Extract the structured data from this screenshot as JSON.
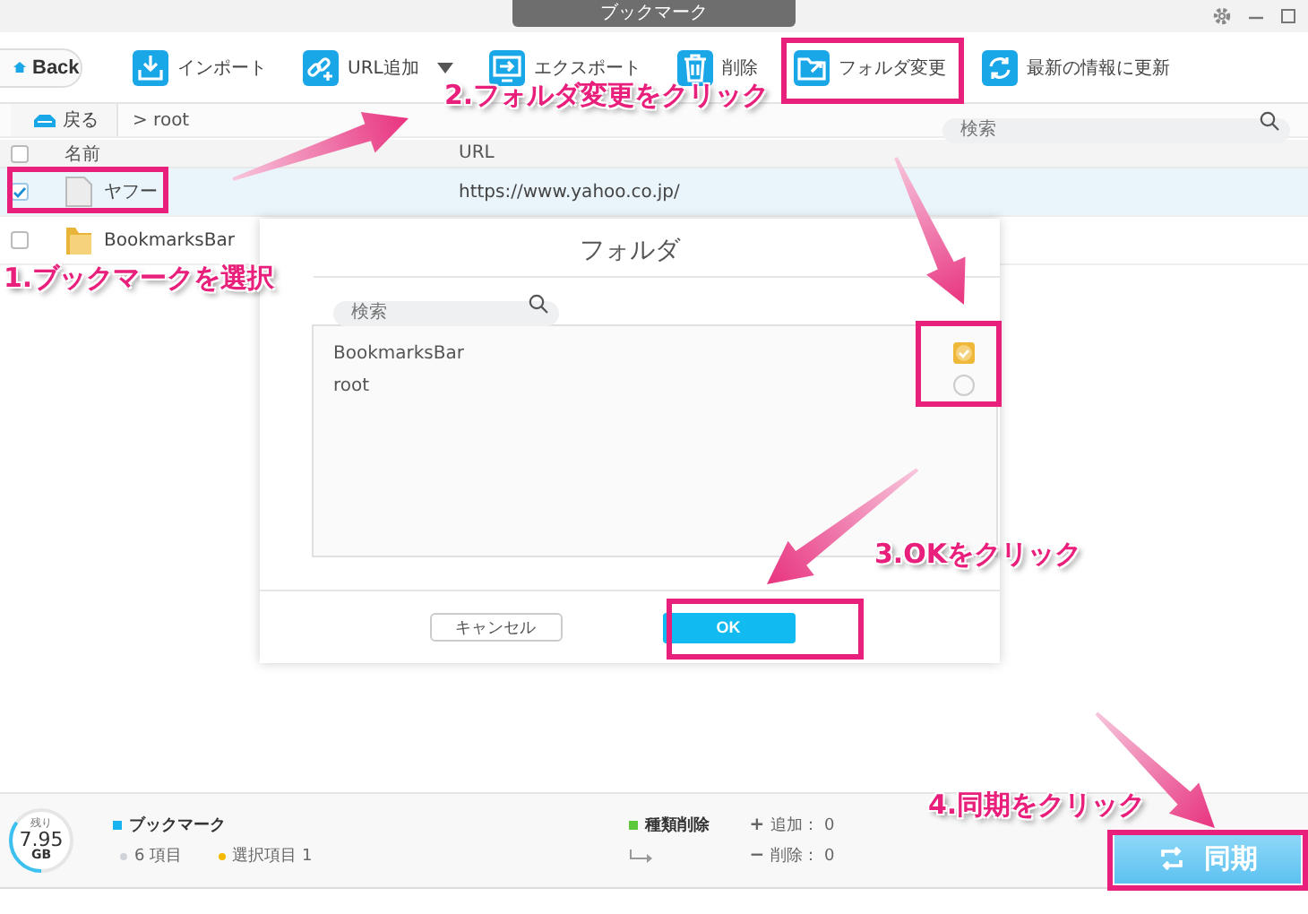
{
  "window": {
    "title": "ブックマーク"
  },
  "toolbar": {
    "back": "Back",
    "items": [
      {
        "kind": "import",
        "label": "インポート",
        "dropdown": false
      },
      {
        "kind": "add-link",
        "label": "URL追加",
        "dropdown": true
      },
      {
        "kind": "export",
        "label": "エクスポート",
        "dropdown": false
      },
      {
        "kind": "delete",
        "label": "削除",
        "dropdown": false
      },
      {
        "kind": "folder",
        "label": "フォルダ変更",
        "dropdown": false
      },
      {
        "kind": "refresh",
        "label": "最新の情報に更新",
        "dropdown": false
      }
    ]
  },
  "navbar": {
    "back": "戻る",
    "path": "> root",
    "search": {
      "placeholder": "検索"
    }
  },
  "table": {
    "all_checked": false,
    "columns": [
      "名前",
      "URL"
    ],
    "rows": [
      {
        "kind": "bookmark",
        "name": "ヤフー",
        "url": "https://www.yahoo.co.jp/",
        "checked": true
      },
      {
        "kind": "folder",
        "name": "BookmarksBar",
        "url": "",
        "checked": false
      }
    ]
  },
  "dialog": {
    "title": "フォルダ",
    "search": {
      "placeholder": "検索"
    },
    "folders": [
      {
        "name": "BookmarksBar",
        "selected": true
      },
      {
        "name": "root",
        "selected": false
      }
    ],
    "cancel": "キャンセル",
    "ok": "OK"
  },
  "status_bar": {
    "storage": {
      "caption": "残り",
      "value": "7.95",
      "unit": "GB",
      "level": 0.35
    },
    "section": {
      "title": "ブックマーク",
      "color": "#19b4ef"
    },
    "counts": [
      {
        "text": "6 項目",
        "color": "#cfd3d8"
      },
      {
        "text": "選択項目 1",
        "color": "#f5b800"
      }
    ],
    "change_type": {
      "title": "種類削除",
      "color": "#5cc83a"
    },
    "changes": [
      {
        "symbol": "+",
        "text": "追加： 0"
      },
      {
        "symbol": "−",
        "text": "削除： 0"
      }
    ],
    "sync": "同期"
  },
  "annotations": {
    "steps": [
      "1.ブックマークを選択",
      "2.フォルダ変更をクリック",
      "3.OKをクリック",
      "4.同期をクリック"
    ]
  }
}
